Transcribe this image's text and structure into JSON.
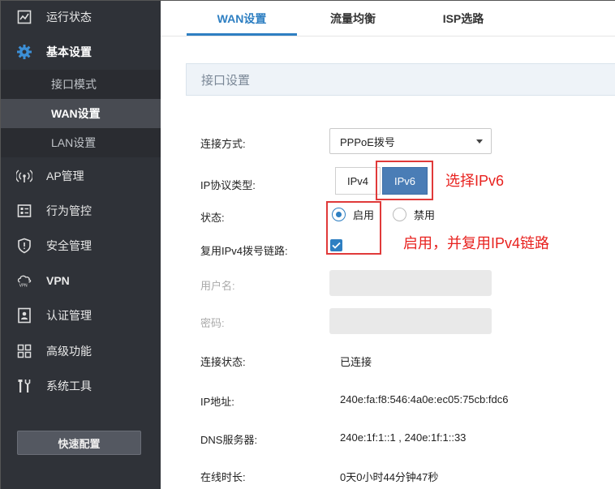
{
  "sidebar": {
    "items": [
      {
        "label": "运行状态",
        "icon": "chart-icon"
      },
      {
        "label": "基本设置",
        "icon": "gear-icon"
      },
      {
        "label": "AP管理",
        "icon": "wireless-ap-icon"
      },
      {
        "label": "行为管控",
        "icon": "behavior-control-icon"
      },
      {
        "label": "安全管理",
        "icon": "shield-icon"
      },
      {
        "label": "VPN",
        "icon": "vpn-cloud-icon"
      },
      {
        "label": "认证管理",
        "icon": "auth-badge-icon"
      },
      {
        "label": "高级功能",
        "icon": "grid-icon"
      },
      {
        "label": "系统工具",
        "icon": "tools-icon"
      }
    ],
    "subitems": [
      {
        "label": "接口模式"
      },
      {
        "label": "WAN设置"
      },
      {
        "label": "LAN设置"
      }
    ],
    "quick_config_label": "快速配置"
  },
  "tabs": [
    {
      "label": "WAN设置"
    },
    {
      "label": "流量均衡"
    },
    {
      "label": "ISP选路"
    }
  ],
  "section": {
    "title": "接口设置"
  },
  "form": {
    "connection_mode": {
      "label": "连接方式:",
      "value": "PPPoE拨号"
    },
    "ip_protocol": {
      "label": "IP协议类型:",
      "options": [
        "IPv4",
        "IPv6"
      ],
      "selected": "IPv6"
    },
    "status": {
      "label": "状态:",
      "options": [
        "启用",
        "禁用"
      ],
      "selected": "启用"
    },
    "reuse_ipv4": {
      "label": "复用IPv4拨号链路:",
      "checked": true
    },
    "username": {
      "label": "用户名:",
      "value": ""
    },
    "password": {
      "label": "密码:",
      "value": ""
    },
    "conn_status": {
      "label": "连接状态:",
      "value": "已连接"
    },
    "ip_address": {
      "label": "IP地址:",
      "value": "240e:fa:f8:546:4a0e:ec05:75cb:fdc6"
    },
    "dns": {
      "label": "DNS服务器:",
      "value": "240e:1f:1::1 , 240e:1f:1::33"
    },
    "uptime": {
      "label": "在线时长:",
      "value": "0天0小时44分钟47秒"
    }
  },
  "annotations": {
    "select_ipv6": "选择IPv6",
    "enable_reuse": "启用，并复用IPv4链路"
  },
  "colors": {
    "accent": "#2e7fc2",
    "sidebar_bg": "#2f3238",
    "annotation": "#e8221f"
  }
}
